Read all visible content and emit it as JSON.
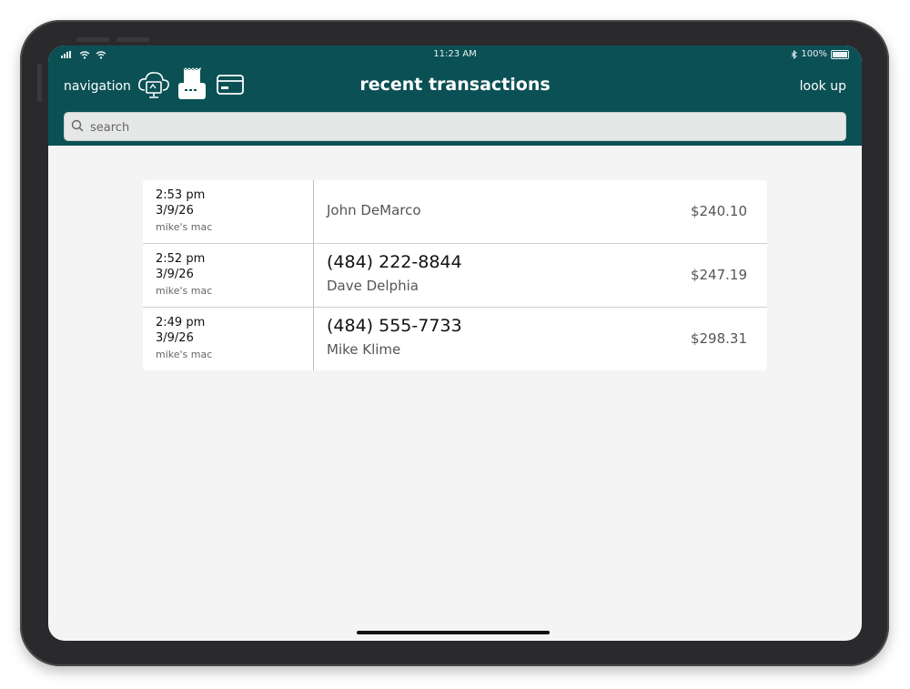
{
  "status": {
    "time": "11:23 AM",
    "battery": "100%"
  },
  "header": {
    "nav_label": "navigation",
    "title": "recent transactions",
    "lookup_label": "look up"
  },
  "search": {
    "placeholder": "search"
  },
  "transactions": [
    {
      "time": "2:53 pm",
      "date": "3/9/26",
      "device": "mike's mac",
      "phone": "",
      "name": "John DeMarco",
      "amount": "$240.10"
    },
    {
      "time": "2:52 pm",
      "date": "3/9/26",
      "device": "mike's mac",
      "phone": "(484) 222-8844",
      "name": "Dave Delphia",
      "amount": "$247.19"
    },
    {
      "time": "2:49 pm",
      "date": "3/9/26",
      "device": "mike's mac",
      "phone": "(484) 555-7733",
      "name": "Mike Klime",
      "amount": "$298.31"
    }
  ],
  "colors": {
    "header_bg": "#0b5055",
    "screen_bg": "#f4f4f4"
  },
  "icons": [
    "cellular-signal-icon",
    "wifi-icon",
    "bluetooth-icon",
    "battery-icon",
    "cloud-register-icon",
    "receipt-printer-icon",
    "credit-card-icon",
    "search-icon"
  ]
}
